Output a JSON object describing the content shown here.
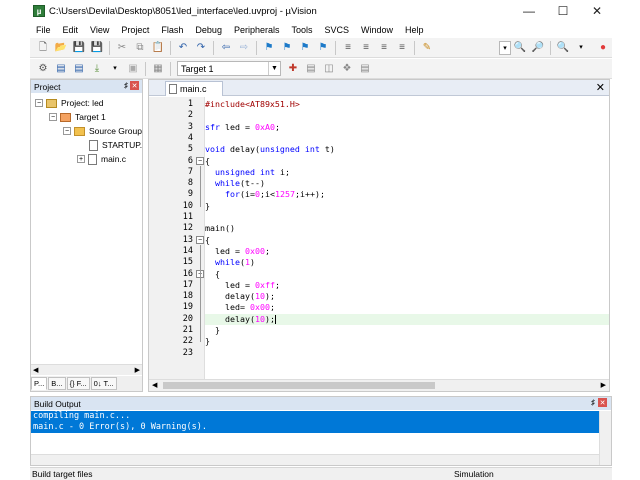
{
  "window": {
    "title": "C:\\Users\\Devila\\Desktop\\8051\\led_interface\\led.uvproj - µVision",
    "app_icon": "keil-uvision-icon"
  },
  "menu": [
    "File",
    "Edit",
    "View",
    "Project",
    "Flash",
    "Debug",
    "Peripherals",
    "Tools",
    "SVCS",
    "Window",
    "Help"
  ],
  "toolbar2": {
    "target_select": "Target 1"
  },
  "project_panel": {
    "title": "Project",
    "tree": [
      {
        "label": "Project: led",
        "indent": 0,
        "expander": "−",
        "icon": "project-icon"
      },
      {
        "label": "Target 1",
        "indent": 1,
        "expander": "−",
        "icon": "target-icon"
      },
      {
        "label": "Source Group",
        "indent": 2,
        "expander": "−",
        "icon": "folder-icon"
      },
      {
        "label": "STARTUP.",
        "indent": 3,
        "expander": "",
        "icon": "file-icon"
      },
      {
        "label": "main.c",
        "indent": 3,
        "expander": "+",
        "icon": "file-icon"
      }
    ],
    "tabs": [
      "P...",
      "B...",
      "{} F...",
      "0↓ T..."
    ]
  },
  "editor": {
    "tab_label": "main.c",
    "current_line": 20,
    "lines": [
      {
        "n": "1",
        "html": "<span class=\"pp\">#include&lt;AT89x51.H&gt;</span>"
      },
      {
        "n": "2",
        "html": ""
      },
      {
        "n": "3",
        "html": "<span class=\"kw\">sfr</span> led = <span class=\"num\">0xA0</span>;"
      },
      {
        "n": "4",
        "html": ""
      },
      {
        "n": "5",
        "html": "<span class=\"kw\">void</span> delay(<span class=\"kw\">unsigned int</span> t)"
      },
      {
        "n": "6",
        "html": "{"
      },
      {
        "n": "7",
        "html": "  <span class=\"kw\">unsigned int</span> i;"
      },
      {
        "n": "8",
        "html": "  <span class=\"kw\">while</span>(t--)"
      },
      {
        "n": "9",
        "html": "    <span class=\"kw\">for</span>(i=<span class=\"num\">0</span>;i&lt;<span class=\"num\">1257</span>;i++);"
      },
      {
        "n": "10",
        "html": "}"
      },
      {
        "n": "11",
        "html": ""
      },
      {
        "n": "12",
        "html": "main()"
      },
      {
        "n": "13",
        "html": "{"
      },
      {
        "n": "14",
        "html": "  led = <span class=\"num\">0x00</span>;"
      },
      {
        "n": "15",
        "html": "  <span class=\"kw\">while</span>(<span class=\"num\">1</span>)"
      },
      {
        "n": "16",
        "html": "  {"
      },
      {
        "n": "17",
        "html": "    led = <span class=\"num\">0xff</span>;"
      },
      {
        "n": "18",
        "html": "    delay(<span class=\"num\">10</span>);"
      },
      {
        "n": "19",
        "html": "    led= <span class=\"num\">0x00</span>;"
      },
      {
        "n": "20",
        "html": "    delay(<span class=\"num\">10</span>);"
      },
      {
        "n": "21",
        "html": "  }"
      },
      {
        "n": "22",
        "html": "}"
      },
      {
        "n": "23",
        "html": ""
      }
    ],
    "folds": [
      {
        "line": 6,
        "sym": "−"
      },
      {
        "line": 13,
        "sym": "−"
      },
      {
        "line": 16,
        "sym": "−"
      }
    ]
  },
  "build_output": {
    "title": "Build Output",
    "lines": [
      "compiling main.c...",
      "main.c - 0 Error(s), 0 Warning(s)."
    ]
  },
  "status": {
    "left": "Build target files",
    "right": "Simulation"
  },
  "colors": {
    "selection": "#0078d7",
    "keyword": "#0000ff",
    "number": "#ff00ff",
    "preprocessor": "#a00000",
    "current_line": "#e8f8e8"
  }
}
